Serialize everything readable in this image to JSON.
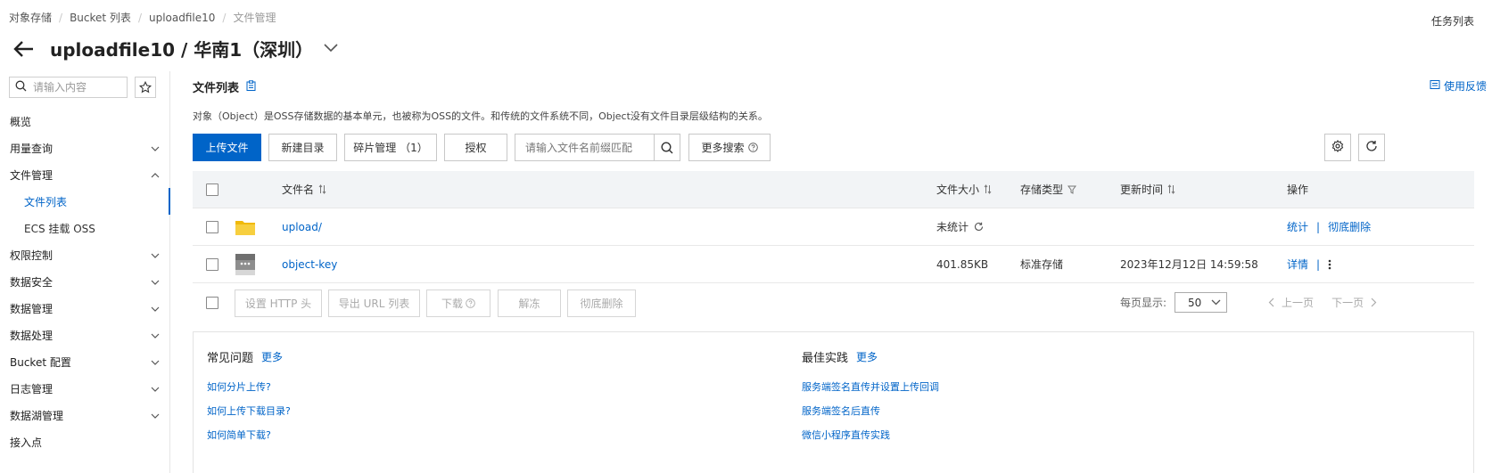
{
  "breadcrumb": [
    "对象存储",
    "Bucket 列表",
    "uploadfile10",
    "文件管理"
  ],
  "task_list": "任务列表",
  "page_title": "uploadfile10 / 华南1（深圳）",
  "sidebar": {
    "search_placeholder": "请输入内容",
    "items": [
      {
        "label": "概览"
      },
      {
        "label": "用量查询"
      },
      {
        "label": "文件管理"
      },
      {
        "label": "文件列表"
      },
      {
        "label": "ECS 挂载 OSS"
      },
      {
        "label": "权限控制"
      },
      {
        "label": "数据安全"
      },
      {
        "label": "数据管理"
      },
      {
        "label": "数据处理"
      },
      {
        "label": "Bucket 配置"
      },
      {
        "label": "日志管理"
      },
      {
        "label": "数据湖管理"
      },
      {
        "label": "接入点"
      }
    ]
  },
  "main": {
    "section_title": "文件列表",
    "feedback": "使用反馈",
    "description": "对象（Object）是OSS存储数据的基本单元，也被称为OSS的文件。和传统的文件系统不同，Object没有文件目录层级结构的关系。",
    "toolbar": {
      "upload": "上传文件",
      "new_dir": "新建目录",
      "fragments": "碎片管理 （1）",
      "authorize": "授权",
      "search_placeholder": "请输入文件名前缀匹配",
      "more_search": "更多搜索"
    },
    "table": {
      "headers": {
        "name": "文件名",
        "size": "文件大小",
        "storage": "存储类型",
        "updated": "更新时间",
        "actions": "操作"
      },
      "rows": [
        {
          "name": "upload/",
          "size": "未统计",
          "storage": "",
          "updated": "",
          "action1": "统计",
          "action2": "彻底删除"
        },
        {
          "name": "object-key",
          "size": "401.85KB",
          "storage": "标准存储",
          "updated": "2023年12月12日 14:59:58",
          "action1": "详情",
          "action2": ""
        }
      ]
    },
    "bulk": {
      "set_http": "设置 HTTP 头",
      "export_url": "导出 URL 列表",
      "download": "下载",
      "unfreeze": "解冻",
      "delete": "彻底删除"
    },
    "pager": {
      "per_page_label": "每页显示:",
      "per_page_value": "50",
      "prev": "上一页",
      "next": "下一页"
    },
    "help": {
      "faq_title": "常见问题",
      "faq_more": "更多",
      "faq_items": [
        "如何分片上传?",
        "如何上传下载目录?",
        "如何简单下载?"
      ],
      "best_title": "最佳实践",
      "best_more": "更多",
      "best_items": [
        "服务端签名直传并设置上传回调",
        "服务端签名后直传",
        "微信小程序直传实践"
      ]
    }
  },
  "colors": {
    "accent": "#0064c8",
    "folder": "#f5c518"
  }
}
